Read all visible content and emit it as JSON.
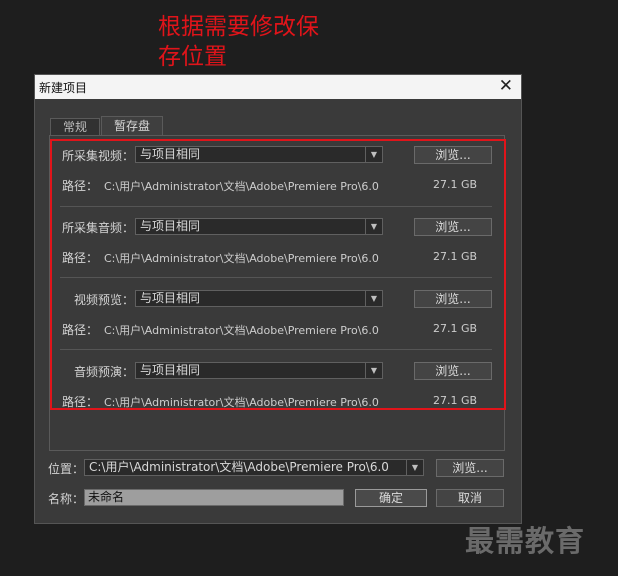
{
  "annotation": {
    "line1": "根据需要修改保",
    "line2": "存位置"
  },
  "dialog": {
    "title": "新建项目",
    "close_glyph": "✕",
    "tabs": [
      {
        "label": "常规",
        "active": false
      },
      {
        "label": "暂存盘",
        "active": true
      }
    ],
    "sections": [
      {
        "label": "所采集视频：",
        "value": "与项目相同",
        "browse": "浏览...",
        "path_label": "路径：",
        "path": "C:\\用户\\Administrator\\文档\\Adobe\\Premiere Pro\\6.0",
        "size": "27.1 GB"
      },
      {
        "label": "所采集音频：",
        "value": "与项目相同",
        "browse": "浏览...",
        "path_label": "路径：",
        "path": "C:\\用户\\Administrator\\文档\\Adobe\\Premiere Pro\\6.0",
        "size": "27.1 GB"
      },
      {
        "label": "视频预览：",
        "value": "与项目相同",
        "browse": "浏览...",
        "path_label": "路径：",
        "path": "C:\\用户\\Administrator\\文档\\Adobe\\Premiere Pro\\6.0",
        "size": "27.1 GB"
      },
      {
        "label": "音频预演：",
        "value": "与项目相同",
        "browse": "浏览...",
        "path_label": "路径：",
        "path": "C:\\用户\\Administrator\\文档\\Adobe\\Premiere Pro\\6.0",
        "size": "27.1 GB"
      }
    ],
    "location": {
      "label": "位置：",
      "value": "C:\\用户\\Administrator\\文档\\Adobe\\Premiere Pro\\6.0",
      "browse": "浏览..."
    },
    "name": {
      "label": "名称：",
      "value": "未命名"
    },
    "ok_label": "确定",
    "cancel_label": "取消"
  },
  "watermark": "最需教育",
  "colors": {
    "annotation": "#e0141a",
    "highlight_border": "#e0141a",
    "dialog_bg": "#3a3a3a",
    "titlebar_bg": "#f4f4f4"
  }
}
